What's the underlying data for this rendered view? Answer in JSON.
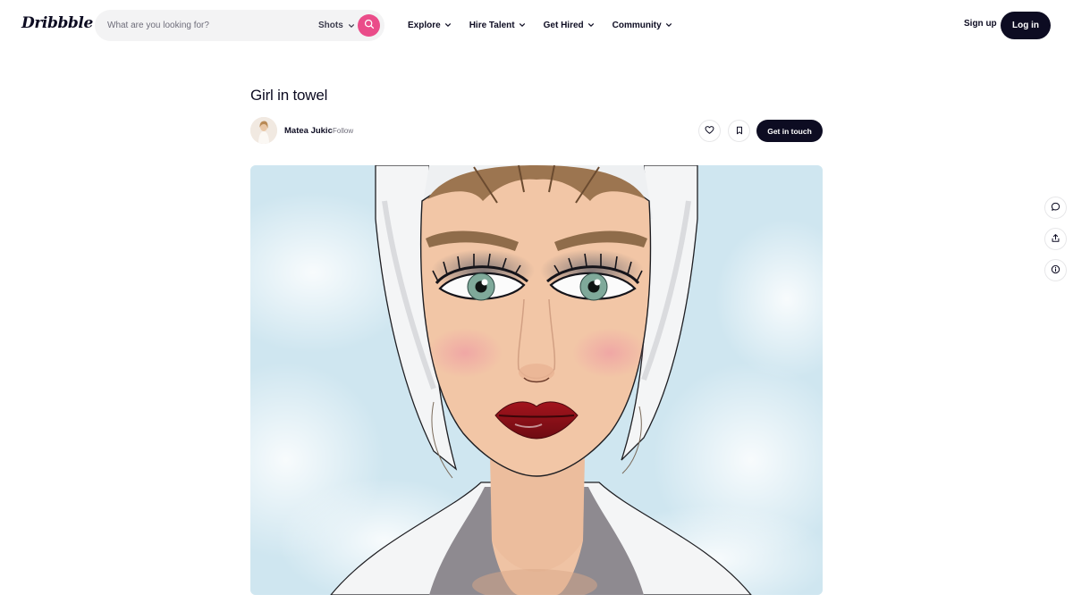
{
  "header": {
    "logo": "Dribbble",
    "search": {
      "placeholder": "What are you looking for?",
      "type": "Shots"
    },
    "nav": [
      "Explore",
      "Hire Talent",
      "Get Hired",
      "Community"
    ],
    "sign_up": "Sign up",
    "log_in": "Log in"
  },
  "shot": {
    "title": "Girl in towel",
    "author": "Matea Jukic",
    "follow": "Follow",
    "get_in_touch": "Get in touch"
  },
  "colors": {
    "brand_pink": "#ea4c89",
    "ink": "#0d0c22",
    "muted": "#6e6d7a",
    "search_bg": "#f3f3f4"
  },
  "icons": {
    "search": "search-icon",
    "like": "heart-icon",
    "save": "bookmark-icon",
    "comments": "comment-icon",
    "share": "share-icon",
    "info": "info-icon"
  }
}
